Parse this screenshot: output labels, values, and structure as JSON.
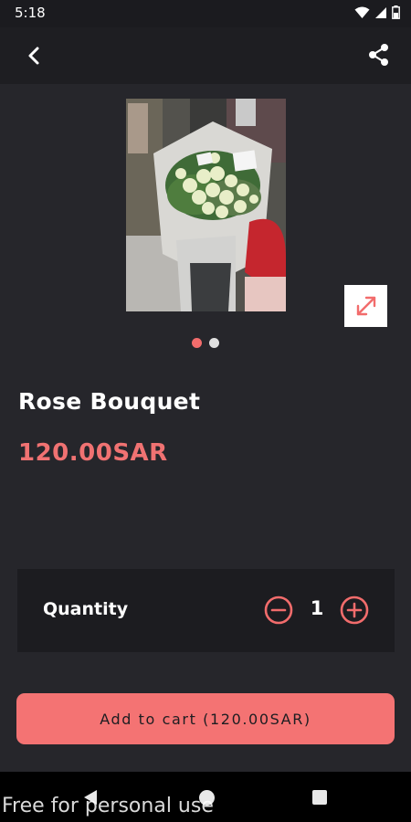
{
  "status_bar": {
    "time": "5:18"
  },
  "app_bar": {
    "back_icon": "back-chevron-icon",
    "share_icon": "share-icon"
  },
  "product": {
    "image_alt": "Rose Bouquet",
    "title": "Rose Bouquet",
    "price": "120.00SAR",
    "image_count": 2,
    "current_image_index": 0
  },
  "quantity": {
    "label": "Quantity",
    "value": "1"
  },
  "cart": {
    "button_label": "Add to cart (120.00SAR)"
  },
  "watermark": "Free for personal use",
  "colors": {
    "accent": "#f47373",
    "price": "#f07272",
    "background": "#26262b",
    "panel": "#1c1c20"
  }
}
